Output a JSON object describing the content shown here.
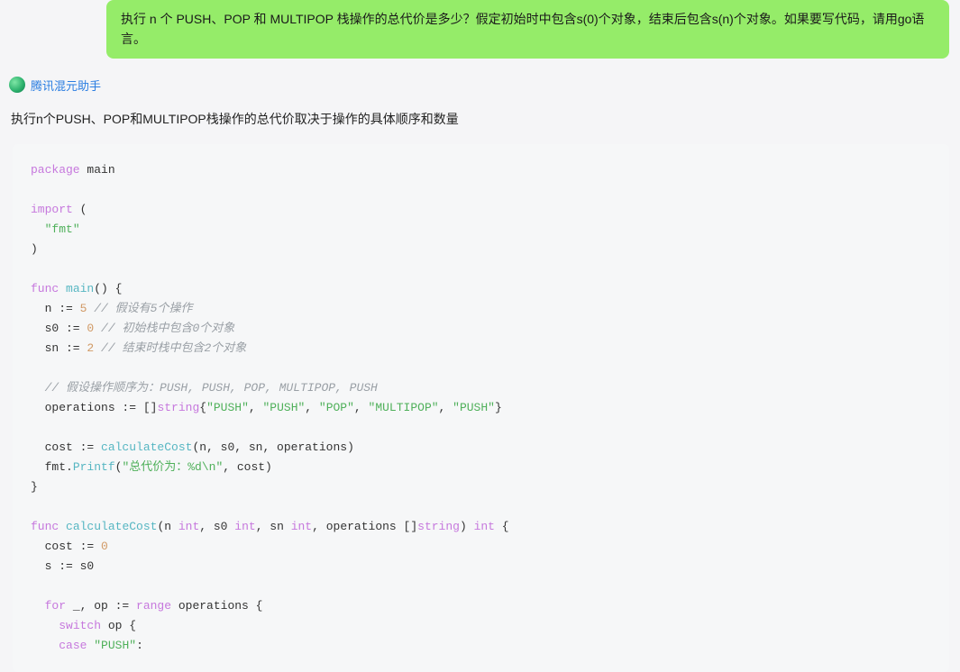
{
  "user_message": "执行 n 个 PUSH、POP 和 MULTIPOP 栈操作的总代价是多少？假定初始时中包含s(0)个对象，结束后包含s(n)个对象。如果要写代码，请用go语言。",
  "assistant": {
    "name": "腾讯混元助手",
    "intro": "执行n个PUSH、POP和MULTIPOP栈操作的总代价取决于操作的具体顺序和数量"
  },
  "code": {
    "l1a": "package",
    "l1b": " main",
    "l3a": "import",
    "l3b": " (",
    "l4a": "  ",
    "l4b": "\"fmt\"",
    "l5": ")",
    "l7a": "func",
    "l7b": " ",
    "l7c": "main",
    "l7d": "() {",
    "l8a": "  n := ",
    "l8b": "5",
    "l8c": " ",
    "l8d": "// 假设有5个操作",
    "l9a": "  s0 := ",
    "l9b": "0",
    "l9c": " ",
    "l9d": "// 初始栈中包含0个对象",
    "l10a": "  sn := ",
    "l10b": "2",
    "l10c": " ",
    "l10d": "// 结束时栈中包含2个对象",
    "l12a": "  ",
    "l12b": "// 假设操作顺序为：PUSH, PUSH, POP, MULTIPOP, PUSH",
    "l13a": "  operations := []",
    "l13b": "string",
    "l13c": "{",
    "l13d": "\"PUSH\"",
    "l13e": ", ",
    "l13f": "\"PUSH\"",
    "l13g": ", ",
    "l13h": "\"POP\"",
    "l13i": ", ",
    "l13j": "\"MULTIPOP\"",
    "l13k": ", ",
    "l13l": "\"PUSH\"",
    "l13m": "}",
    "l15a": "  cost := ",
    "l15b": "calculateCost",
    "l15c": "(n, s0, sn, operations)",
    "l16a": "  fmt.",
    "l16b": "Printf",
    "l16c": "(",
    "l16d": "\"总代价为：%d\\n\"",
    "l16e": ", cost)",
    "l17": "}",
    "l19a": "func",
    "l19b": " ",
    "l19c": "calculateCost",
    "l19d": "(n ",
    "l19e": "int",
    "l19f": ", s0 ",
    "l19g": "int",
    "l19h": ", sn ",
    "l19i": "int",
    "l19j": ", operations []",
    "l19k": "string",
    "l19l": ") ",
    "l19m": "int",
    "l19n": " {",
    "l20a": "  cost := ",
    "l20b": "0",
    "l21": "  s := s0",
    "l23a": "  ",
    "l23b": "for",
    "l23c": " _, op := ",
    "l23d": "range",
    "l23e": " operations {",
    "l24a": "    ",
    "l24b": "switch",
    "l24c": " op {",
    "l25a": "    ",
    "l25b": "case",
    "l25c": " ",
    "l25d": "\"PUSH\"",
    "l25e": ":"
  }
}
